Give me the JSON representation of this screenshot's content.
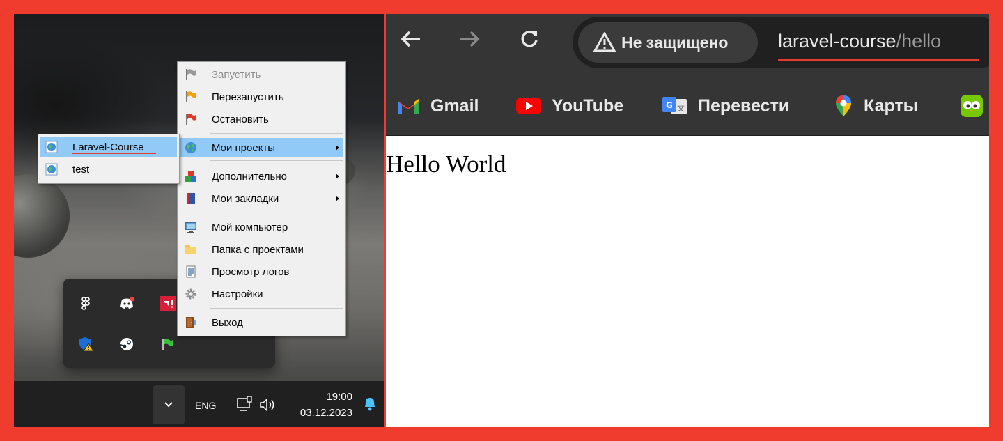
{
  "colors": {
    "frame": "#f03c2e",
    "menu_highlight": "#91c9f7",
    "underline": "#e53b2c"
  },
  "desktop": {
    "tray_overflow": {
      "icons": [
        "figma-icon",
        "discord-icon",
        "amd-icon",
        "windows-security-icon",
        "steam-icon",
        "openserver-flag-icon"
      ]
    },
    "context_menu": {
      "items": [
        {
          "label": "Запустить",
          "icon": "gray-flag-icon",
          "disabled": true
        },
        {
          "label": "Перезапустить",
          "icon": "orange-flag-icon",
          "disabled": false
        },
        {
          "label": "Остановить",
          "icon": "red-flag-icon",
          "disabled": false
        },
        {
          "label": "Мои проекты",
          "icon": "globe-icon",
          "highlighted": true,
          "submenu": true
        },
        {
          "label": "Дополнительно",
          "icon": "blocks-icon",
          "submenu": true
        },
        {
          "label": "Мои закладки",
          "icon": "book-icon",
          "submenu": true
        },
        {
          "label": "Мой компьютер",
          "icon": "computer-icon"
        },
        {
          "label": "Папка с проектами",
          "icon": "folder-icon"
        },
        {
          "label": "Просмотр логов",
          "icon": "log-icon"
        },
        {
          "label": "Настройки",
          "icon": "gear-icon"
        },
        {
          "label": "Выход",
          "icon": "door-icon"
        }
      ]
    },
    "projects_submenu": {
      "items": [
        {
          "label": "Laravel-Course",
          "icon": "globe-page-icon",
          "highlighted": true
        },
        {
          "label": "test",
          "icon": "globe-page-icon"
        }
      ]
    },
    "taskbar": {
      "language": "ENG",
      "time": "19:00",
      "date": "03.12.2023"
    }
  },
  "browser": {
    "security_label": "Не защищено",
    "url_host": "laravel-course",
    "url_path": "/hello",
    "bookmarks": [
      {
        "label": "Gmail",
        "icon": "gmail-icon"
      },
      {
        "label": "YouTube",
        "icon": "youtube-icon"
      },
      {
        "label": "Перевести",
        "icon": "google-translate-icon"
      },
      {
        "label": "Карты",
        "icon": "google-maps-icon"
      },
      {
        "label": "",
        "icon": "duolingo-icon"
      }
    ],
    "page_text": "Hello World"
  }
}
